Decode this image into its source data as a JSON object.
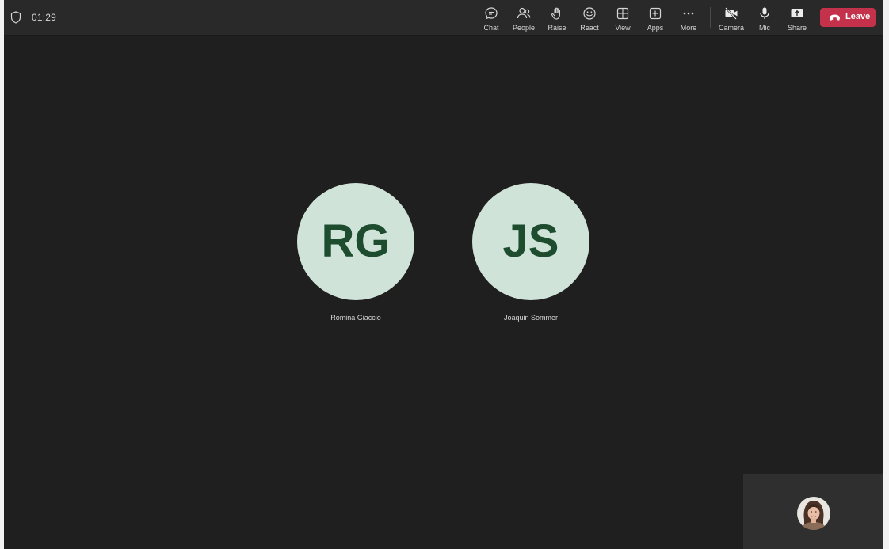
{
  "header": {
    "timer": "01:29"
  },
  "toolbar": {
    "items": [
      {
        "id": "chat",
        "label": "Chat",
        "icon": "chat-icon"
      },
      {
        "id": "people",
        "label": "People",
        "icon": "people-icon"
      },
      {
        "id": "raise",
        "label": "Raise",
        "icon": "hand-icon"
      },
      {
        "id": "react",
        "label": "React",
        "icon": "smiley-icon"
      },
      {
        "id": "view",
        "label": "View",
        "icon": "grid-icon"
      },
      {
        "id": "apps",
        "label": "Apps",
        "icon": "plus-square-icon"
      },
      {
        "id": "more",
        "label": "More",
        "icon": "ellipsis-icon"
      },
      {
        "id": "camera",
        "label": "Camera",
        "icon": "camera-off-icon"
      },
      {
        "id": "mic",
        "label": "Mic",
        "icon": "mic-icon"
      },
      {
        "id": "share",
        "label": "Share",
        "icon": "share-icon"
      }
    ],
    "leave_label": "Leave"
  },
  "participants": [
    {
      "initials": "RG",
      "name": "Romina Giaccio"
    },
    {
      "initials": "JS",
      "name": "Joaquin Sommer"
    }
  ],
  "colors": {
    "background": "#1f1f1f",
    "topbar": "#292929",
    "leave": "#c4314b",
    "avatar_bg": "#cfe3d8",
    "avatar_text": "#1d4c2e"
  }
}
